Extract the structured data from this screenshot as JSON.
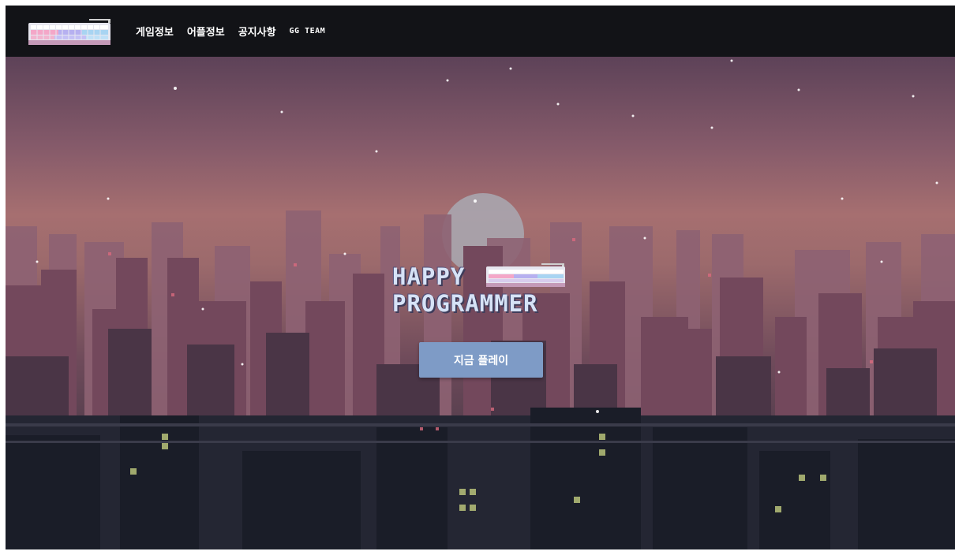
{
  "nav": {
    "items": [
      {
        "label": "게임정보"
      },
      {
        "label": "어플정보"
      },
      {
        "label": "공지사항"
      },
      {
        "label": "GG TEAM"
      }
    ]
  },
  "hero": {
    "title_line1": "HAPPY",
    "title_line2": "PROGRAMMER",
    "play_label": "지금 플레이"
  },
  "colors": {
    "navbar": "#121317",
    "button": "#7e9bc6",
    "title": "#d6e2f6"
  }
}
